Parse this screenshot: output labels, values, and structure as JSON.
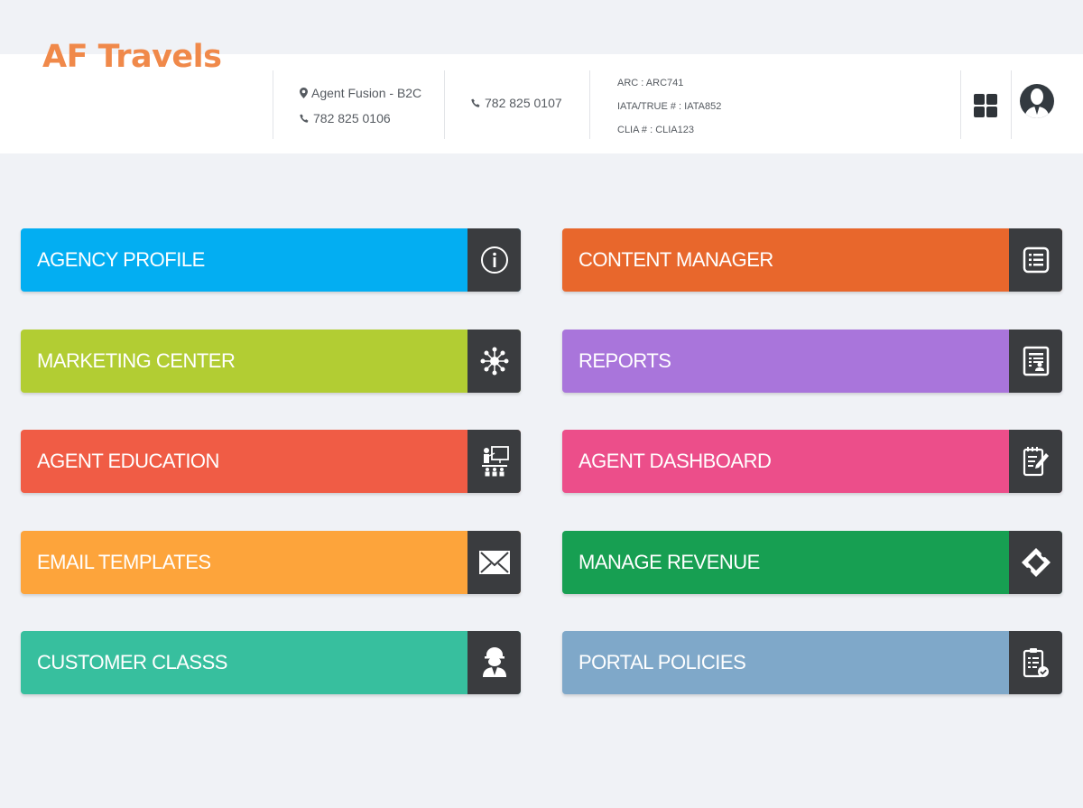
{
  "header": {
    "logo": "AF Travels",
    "agent_name": "Agent Fusion - B2C",
    "agent_phone": "782 825 0106",
    "office_phone": "782 825 0107",
    "arc": "ARC : ARC741",
    "iata": "IATA/TRUE # : IATA852",
    "clia": "CLIA # : CLIA123"
  },
  "icons": {
    "location": "map-marker-icon",
    "phone": "phone-icon",
    "apps": "grid-icon",
    "user": "user-avatar-icon"
  },
  "tiles": [
    {
      "label": "AGENCY PROFILE",
      "color": "#03aef2",
      "icon": "info-icon"
    },
    {
      "label": "CONTENT MANAGER",
      "color": "#e8672c",
      "icon": "list-icon"
    },
    {
      "label": "MARKETING CENTER",
      "color": "#b2cd33",
      "icon": "network-icon"
    },
    {
      "label": "REPORTS",
      "color": "#a975db",
      "icon": "report-icon"
    },
    {
      "label": "AGENT EDUCATION",
      "color": "#f05c45",
      "icon": "presentation-icon"
    },
    {
      "label": "AGENT DASHBOARD",
      "color": "#ec4e8a",
      "icon": "edit-notepad-icon"
    },
    {
      "label": "EMAIL TEMPLATES",
      "color": "#fda43b",
      "icon": "envelope-icon"
    },
    {
      "label": "MANAGE REVENUE",
      "color": "#179f52",
      "icon": "ticket-icon"
    },
    {
      "label": "CUSTOMER CLASSS",
      "color": "#37bf9e",
      "icon": "engineer-icon"
    },
    {
      "label": "PORTAL POLICIES",
      "color": "#7fa8c9",
      "icon": "clipboard-check-icon"
    }
  ]
}
